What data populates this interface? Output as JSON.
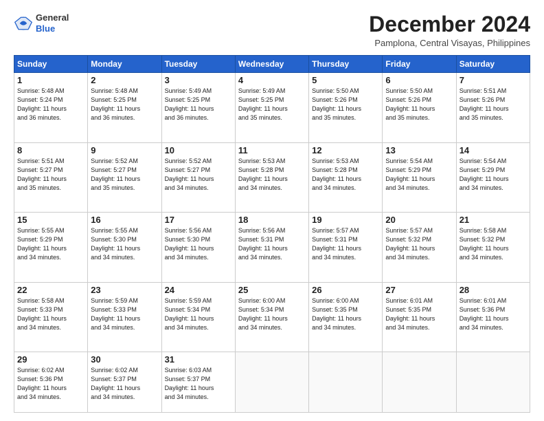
{
  "header": {
    "logo_general": "General",
    "logo_blue": "Blue",
    "month_title": "December 2024",
    "location": "Pamplona, Central Visayas, Philippines"
  },
  "weekdays": [
    "Sunday",
    "Monday",
    "Tuesday",
    "Wednesday",
    "Thursday",
    "Friday",
    "Saturday"
  ],
  "weeks": [
    [
      {
        "day": "1",
        "info": "Sunrise: 5:48 AM\nSunset: 5:24 PM\nDaylight: 11 hours\nand 36 minutes."
      },
      {
        "day": "2",
        "info": "Sunrise: 5:48 AM\nSunset: 5:25 PM\nDaylight: 11 hours\nand 36 minutes."
      },
      {
        "day": "3",
        "info": "Sunrise: 5:49 AM\nSunset: 5:25 PM\nDaylight: 11 hours\nand 36 minutes."
      },
      {
        "day": "4",
        "info": "Sunrise: 5:49 AM\nSunset: 5:25 PM\nDaylight: 11 hours\nand 35 minutes."
      },
      {
        "day": "5",
        "info": "Sunrise: 5:50 AM\nSunset: 5:26 PM\nDaylight: 11 hours\nand 35 minutes."
      },
      {
        "day": "6",
        "info": "Sunrise: 5:50 AM\nSunset: 5:26 PM\nDaylight: 11 hours\nand 35 minutes."
      },
      {
        "day": "7",
        "info": "Sunrise: 5:51 AM\nSunset: 5:26 PM\nDaylight: 11 hours\nand 35 minutes."
      }
    ],
    [
      {
        "day": "8",
        "info": "Sunrise: 5:51 AM\nSunset: 5:27 PM\nDaylight: 11 hours\nand 35 minutes."
      },
      {
        "day": "9",
        "info": "Sunrise: 5:52 AM\nSunset: 5:27 PM\nDaylight: 11 hours\nand 35 minutes."
      },
      {
        "day": "10",
        "info": "Sunrise: 5:52 AM\nSunset: 5:27 PM\nDaylight: 11 hours\nand 34 minutes."
      },
      {
        "day": "11",
        "info": "Sunrise: 5:53 AM\nSunset: 5:28 PM\nDaylight: 11 hours\nand 34 minutes."
      },
      {
        "day": "12",
        "info": "Sunrise: 5:53 AM\nSunset: 5:28 PM\nDaylight: 11 hours\nand 34 minutes."
      },
      {
        "day": "13",
        "info": "Sunrise: 5:54 AM\nSunset: 5:29 PM\nDaylight: 11 hours\nand 34 minutes."
      },
      {
        "day": "14",
        "info": "Sunrise: 5:54 AM\nSunset: 5:29 PM\nDaylight: 11 hours\nand 34 minutes."
      }
    ],
    [
      {
        "day": "15",
        "info": "Sunrise: 5:55 AM\nSunset: 5:29 PM\nDaylight: 11 hours\nand 34 minutes."
      },
      {
        "day": "16",
        "info": "Sunrise: 5:55 AM\nSunset: 5:30 PM\nDaylight: 11 hours\nand 34 minutes."
      },
      {
        "day": "17",
        "info": "Sunrise: 5:56 AM\nSunset: 5:30 PM\nDaylight: 11 hours\nand 34 minutes."
      },
      {
        "day": "18",
        "info": "Sunrise: 5:56 AM\nSunset: 5:31 PM\nDaylight: 11 hours\nand 34 minutes."
      },
      {
        "day": "19",
        "info": "Sunrise: 5:57 AM\nSunset: 5:31 PM\nDaylight: 11 hours\nand 34 minutes."
      },
      {
        "day": "20",
        "info": "Sunrise: 5:57 AM\nSunset: 5:32 PM\nDaylight: 11 hours\nand 34 minutes."
      },
      {
        "day": "21",
        "info": "Sunrise: 5:58 AM\nSunset: 5:32 PM\nDaylight: 11 hours\nand 34 minutes."
      }
    ],
    [
      {
        "day": "22",
        "info": "Sunrise: 5:58 AM\nSunset: 5:33 PM\nDaylight: 11 hours\nand 34 minutes."
      },
      {
        "day": "23",
        "info": "Sunrise: 5:59 AM\nSunset: 5:33 PM\nDaylight: 11 hours\nand 34 minutes."
      },
      {
        "day": "24",
        "info": "Sunrise: 5:59 AM\nSunset: 5:34 PM\nDaylight: 11 hours\nand 34 minutes."
      },
      {
        "day": "25",
        "info": "Sunrise: 6:00 AM\nSunset: 5:34 PM\nDaylight: 11 hours\nand 34 minutes."
      },
      {
        "day": "26",
        "info": "Sunrise: 6:00 AM\nSunset: 5:35 PM\nDaylight: 11 hours\nand 34 minutes."
      },
      {
        "day": "27",
        "info": "Sunrise: 6:01 AM\nSunset: 5:35 PM\nDaylight: 11 hours\nand 34 minutes."
      },
      {
        "day": "28",
        "info": "Sunrise: 6:01 AM\nSunset: 5:36 PM\nDaylight: 11 hours\nand 34 minutes."
      }
    ],
    [
      {
        "day": "29",
        "info": "Sunrise: 6:02 AM\nSunset: 5:36 PM\nDaylight: 11 hours\nand 34 minutes."
      },
      {
        "day": "30",
        "info": "Sunrise: 6:02 AM\nSunset: 5:37 PM\nDaylight: 11 hours\nand 34 minutes."
      },
      {
        "day": "31",
        "info": "Sunrise: 6:03 AM\nSunset: 5:37 PM\nDaylight: 11 hours\nand 34 minutes."
      },
      {
        "day": "",
        "info": ""
      },
      {
        "day": "",
        "info": ""
      },
      {
        "day": "",
        "info": ""
      },
      {
        "day": "",
        "info": ""
      }
    ]
  ]
}
